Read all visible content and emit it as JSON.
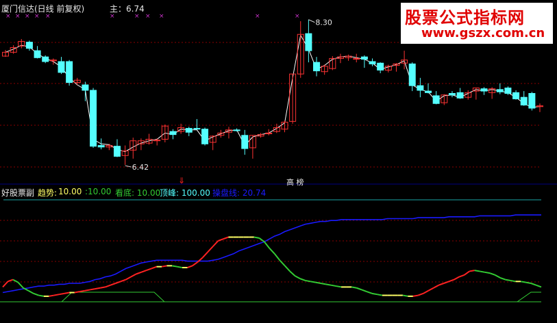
{
  "header": {
    "title": "厦门信达(日线 前复权)",
    "price_label": "主：6.74"
  },
  "watermark": {
    "line1": "股票公式指标网",
    "line2": "www.gszx.com.cn"
  },
  "lower_header": {
    "name": "好股票副",
    "trend_label": "趋势:",
    "trend_value": "10.00",
    "v2": ":10.00",
    "look_bottom": "看底: 10.00",
    "top": "顶峰: 100.00",
    "control": "操盘线: 20.74"
  },
  "markers": {
    "red_arrow": "⇓",
    "bottom_tag": "高 榜"
  },
  "colors": {
    "up": "#ff3333",
    "down": "#54ffff",
    "ma": "#ffffff",
    "trend_red": "#ff2222",
    "trend_yellow": "#ffff66",
    "trend_green": "#33cc33",
    "control": "#1a1aff",
    "grid": "#8b0000",
    "axis": "#000080"
  },
  "chart_data": [
    {
      "type": "candlestick",
      "title": "厦门信达(日线 前复权)",
      "annotations": [
        {
          "text": "8.30",
          "index": 38,
          "value": 8.3
        },
        {
          "text": "6.42",
          "index": 15,
          "value": 6.42
        }
      ],
      "ohlc": [
        [
          7.83,
          7.91,
          7.82,
          7.88
        ],
        [
          7.88,
          7.97,
          7.86,
          7.94
        ],
        [
          7.96,
          8.05,
          7.93,
          8.02
        ],
        [
          8.01,
          8.03,
          7.9,
          7.93
        ],
        [
          7.9,
          7.96,
          7.8,
          7.81
        ],
        [
          7.82,
          7.84,
          7.74,
          7.76
        ],
        [
          7.77,
          7.8,
          7.72,
          7.78
        ],
        [
          7.76,
          7.82,
          7.6,
          7.62
        ],
        [
          7.76,
          7.78,
          7.45,
          7.49
        ],
        [
          7.49,
          7.55,
          7.46,
          7.52
        ],
        [
          7.46,
          7.5,
          7.25,
          7.39
        ],
        [
          7.39,
          7.42,
          6.65,
          6.67
        ],
        [
          6.68,
          6.77,
          6.63,
          6.66
        ],
        [
          6.66,
          6.7,
          6.62,
          6.68
        ],
        [
          6.67,
          6.76,
          6.53,
          6.54
        ],
        [
          6.55,
          6.68,
          6.43,
          6.61
        ],
        [
          6.62,
          6.78,
          6.51,
          6.74
        ],
        [
          6.7,
          6.77,
          6.62,
          6.74
        ],
        [
          6.71,
          6.83,
          6.69,
          6.76
        ],
        [
          6.74,
          6.77,
          6.68,
          6.75
        ],
        [
          6.76,
          6.95,
          6.72,
          6.93
        ],
        [
          6.86,
          6.89,
          6.76,
          6.82
        ],
        [
          6.86,
          6.96,
          6.83,
          6.91
        ],
        [
          6.9,
          6.92,
          6.8,
          6.85
        ],
        [
          6.9,
          7.02,
          6.88,
          6.89
        ],
        [
          6.89,
          6.91,
          6.68,
          6.7
        ],
        [
          6.72,
          6.81,
          6.62,
          6.8
        ],
        [
          6.81,
          6.88,
          6.78,
          6.84
        ],
        [
          6.85,
          6.92,
          6.77,
          6.88
        ],
        [
          6.88,
          6.9,
          6.86,
          6.87
        ],
        [
          6.81,
          6.88,
          6.56,
          6.64
        ],
        [
          6.65,
          6.81,
          6.51,
          6.81
        ],
        [
          6.8,
          6.84,
          6.78,
          6.82
        ],
        [
          6.83,
          6.89,
          6.81,
          6.84
        ],
        [
          6.86,
          6.96,
          6.84,
          6.91
        ],
        [
          6.89,
          7.0,
          6.85,
          6.98
        ],
        [
          6.99,
          7.6,
          6.96,
          7.6
        ],
        [
          7.6,
          8.28,
          7.55,
          8.11
        ],
        [
          8.12,
          8.3,
          7.75,
          7.9
        ],
        [
          7.75,
          7.82,
          7.57,
          7.64
        ],
        [
          7.63,
          7.72,
          7.59,
          7.7
        ],
        [
          7.67,
          7.83,
          7.65,
          7.8
        ],
        [
          7.8,
          7.86,
          7.74,
          7.82
        ],
        [
          7.81,
          7.85,
          7.77,
          7.83
        ],
        [
          7.8,
          7.86,
          7.75,
          7.8
        ],
        [
          7.82,
          7.84,
          7.68,
          7.79
        ],
        [
          7.76,
          7.8,
          7.7,
          7.73
        ],
        [
          7.74,
          7.75,
          7.61,
          7.65
        ],
        [
          7.65,
          7.72,
          7.62,
          7.7
        ],
        [
          7.71,
          7.74,
          7.63,
          7.73
        ],
        [
          7.74,
          7.9,
          7.66,
          7.78
        ],
        [
          7.73,
          7.75,
          7.38,
          7.45
        ],
        [
          7.45,
          7.55,
          7.3,
          7.39
        ],
        [
          7.38,
          7.48,
          7.35,
          7.36
        ],
        [
          7.32,
          7.38,
          7.21,
          7.22
        ],
        [
          7.23,
          7.34,
          7.2,
          7.33
        ],
        [
          7.35,
          7.38,
          7.3,
          7.33
        ],
        [
          7.36,
          7.42,
          7.28,
          7.29
        ],
        [
          7.3,
          7.39,
          7.27,
          7.36
        ],
        [
          7.38,
          7.42,
          7.27,
          7.42
        ],
        [
          7.41,
          7.43,
          7.33,
          7.38
        ],
        [
          7.36,
          7.43,
          7.28,
          7.41
        ],
        [
          7.4,
          7.48,
          7.34,
          7.37
        ],
        [
          7.42,
          7.44,
          7.33,
          7.35
        ],
        [
          7.36,
          7.39,
          7.27,
          7.28
        ],
        [
          7.3,
          7.38,
          7.19,
          7.2
        ],
        [
          7.35,
          7.37,
          7.13,
          7.16
        ],
        [
          7.18,
          7.22,
          7.11,
          7.19
        ]
      ],
      "ma": [
        7.88,
        7.92,
        7.97,
        7.95,
        7.86,
        7.8,
        7.76,
        7.69,
        7.55,
        7.46,
        7.4,
        6.76,
        6.7,
        6.69,
        6.63,
        6.6,
        6.66,
        6.71,
        6.74,
        6.76,
        6.84,
        6.82,
        6.89,
        6.88,
        6.88,
        6.74,
        6.79,
        6.83,
        6.87,
        6.88,
        6.68,
        6.79,
        6.82,
        6.84,
        6.9,
        6.97,
        7.55,
        8.1,
        7.92,
        7.66,
        7.71,
        7.79,
        7.82,
        7.83,
        7.81,
        7.79,
        7.74,
        7.66,
        7.69,
        7.72,
        7.77,
        7.46,
        7.4,
        7.37,
        7.25,
        7.32,
        7.33,
        7.3,
        7.35,
        7.4,
        7.38,
        7.4,
        7.38,
        7.36,
        7.3,
        7.22,
        7.17,
        7.18
      ]
    },
    {
      "type": "line",
      "title": "好股票副",
      "series": [
        {
          "name": "趋势",
          "values": [
            16,
            22,
            24,
            21,
            15,
            12,
            9,
            7,
            6,
            6,
            7,
            8,
            9,
            10,
            10,
            11,
            12,
            13,
            14,
            15,
            16,
            18,
            20,
            22,
            24,
            27,
            30,
            32,
            34,
            36,
            38,
            38,
            39,
            39,
            38,
            37,
            37,
            39,
            43,
            48,
            54,
            60,
            66,
            68,
            70,
            70,
            70,
            70,
            70,
            70,
            69,
            65,
            58,
            52,
            45,
            39,
            33,
            28,
            25,
            23,
            22,
            21,
            20,
            19,
            18,
            17,
            16,
            16,
            16,
            15,
            13,
            11,
            9,
            8,
            7,
            7,
            7,
            7,
            7,
            6,
            6,
            7,
            9,
            12,
            15,
            18,
            20,
            22,
            24,
            27,
            29,
            33,
            34,
            33,
            32,
            31,
            29,
            26,
            24,
            23,
            22,
            22,
            21,
            20,
            18,
            16
          ]
        },
        {
          "name": "操盘线",
          "values": [
            10,
            11,
            12,
            13,
            14,
            15,
            16,
            17,
            17,
            18,
            18,
            19,
            19,
            20,
            20,
            20,
            21,
            22,
            24,
            25,
            27,
            28,
            30,
            33,
            36,
            38,
            40,
            42,
            43,
            44,
            45,
            45,
            45,
            45,
            45,
            45,
            44,
            44,
            44,
            44,
            44,
            45,
            46,
            48,
            50,
            52,
            55,
            57,
            59,
            61,
            63,
            65,
            68,
            71,
            73,
            76,
            78,
            80,
            82,
            84,
            85,
            86,
            87,
            87,
            88,
            88,
            89,
            89,
            89,
            89,
            89,
            89,
            89,
            89,
            89,
            90,
            90,
            90,
            90,
            90,
            90,
            91,
            91,
            91,
            91,
            91,
            91,
            92,
            92,
            92,
            92,
            92,
            92,
            93,
            93,
            93,
            93,
            93,
            93,
            93,
            94,
            94,
            94,
            94,
            94,
            94
          ]
        }
      ]
    }
  ]
}
